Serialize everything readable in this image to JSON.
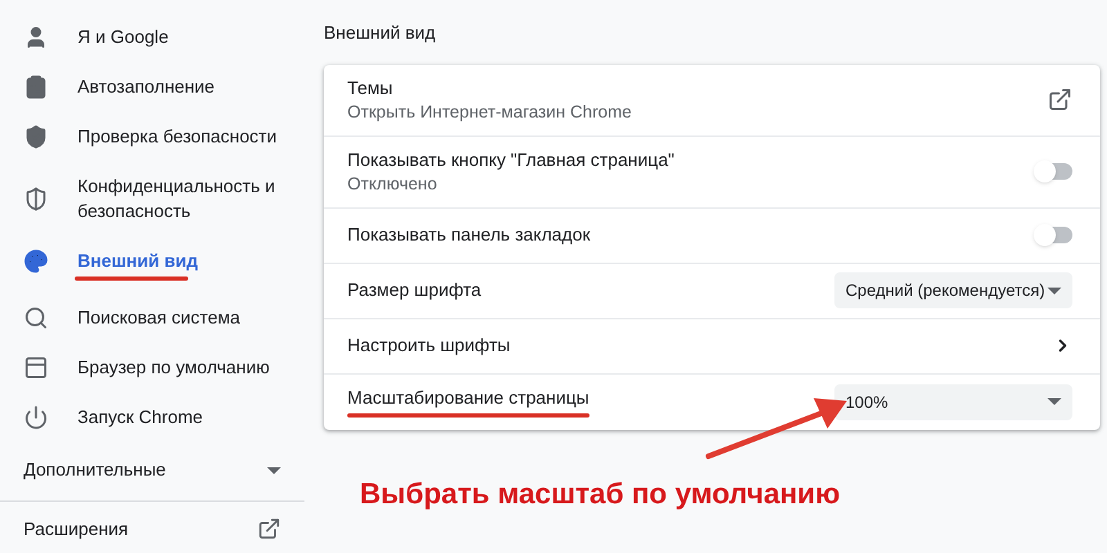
{
  "sidebar": {
    "items": [
      {
        "label": "Я и Google",
        "selected": false,
        "underlined": false
      },
      {
        "label": "Автозаполнение",
        "selected": false,
        "underlined": false
      },
      {
        "label": "Проверка безопасности",
        "selected": false,
        "underlined": false
      },
      {
        "label": "Конфиденциальность и безопасность",
        "selected": false,
        "underlined": false
      },
      {
        "label": "Внешний вид",
        "selected": true,
        "underlined": true
      },
      {
        "label": "Поисковая система",
        "selected": false,
        "underlined": false
      },
      {
        "label": "Браузер по умолчанию",
        "selected": false,
        "underlined": false
      },
      {
        "label": "Запуск Chrome",
        "selected": false,
        "underlined": false
      }
    ],
    "advanced": {
      "label": "Дополнительные",
      "expanded": false
    },
    "extensions": {
      "label": "Расширения"
    }
  },
  "section": {
    "title": "Внешний вид",
    "rows": [
      {
        "kind": "link",
        "label": "Темы",
        "sublabel": "Открыть Интернет-магазин Chrome",
        "underlined": false
      },
      {
        "kind": "toggle",
        "label": "Показывать кнопку \"Главная страница\"",
        "sublabel": "Отключено",
        "on": false,
        "underlined": false
      },
      {
        "kind": "toggle",
        "label": "Показывать панель закладок",
        "on": false,
        "underlined": false
      },
      {
        "kind": "select",
        "label": "Размер шрифта",
        "value": "Средний (рекомендуется)",
        "underlined": false
      },
      {
        "kind": "arrow",
        "label": "Настроить шрифты",
        "underlined": false
      },
      {
        "kind": "select",
        "label": "Масштабирование страницы",
        "value": "100%",
        "underlined": true
      }
    ]
  },
  "annotation": {
    "text": "Выбрать масштаб по умолчанию"
  }
}
